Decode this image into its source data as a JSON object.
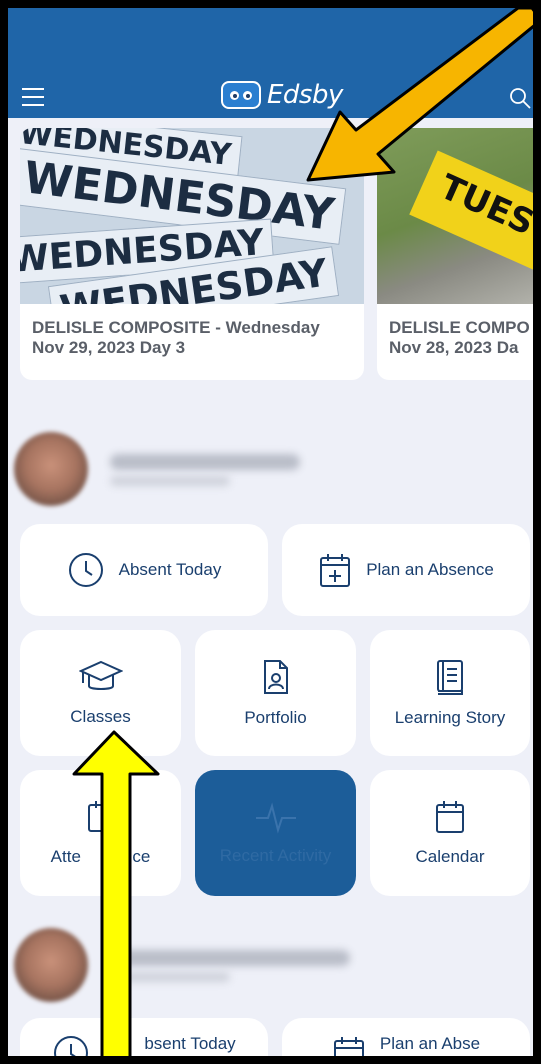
{
  "app": {
    "name": "Edsby"
  },
  "news": [
    {
      "title": "DELISLE COMPOSITE - Wednesday",
      "date": "Nov 29, 2023 Day 3",
      "image_words": [
        "WEDNESDAY",
        "WEDNESDAY",
        "WEDNESDAY",
        "WEDNESDAY"
      ]
    },
    {
      "title": "DELISLE COMPO",
      "date": "Nov 28, 2023 Da",
      "image_word": "TUES"
    }
  ],
  "quick_actions": {
    "absent_today": "Absent Today",
    "plan_absence": "Plan an Absence",
    "classes": "Classes",
    "portfolio": "Portfolio",
    "learning_story": "Learning Story",
    "attendance_left": "Atte",
    "attendance_right": "nce",
    "recent_activity": "Recent Activity",
    "calendar": "Calendar"
  },
  "second_student": {
    "absent_today": "bsent Today",
    "plan_absence": "Plan an Abse"
  },
  "colors": {
    "header": "#1f65a8",
    "accent": "#1a3f6e",
    "active_tile": "#1c5d99",
    "background": "#eef0f8",
    "arrow_orange": "#f7b500",
    "arrow_yellow": "#ffff00"
  }
}
